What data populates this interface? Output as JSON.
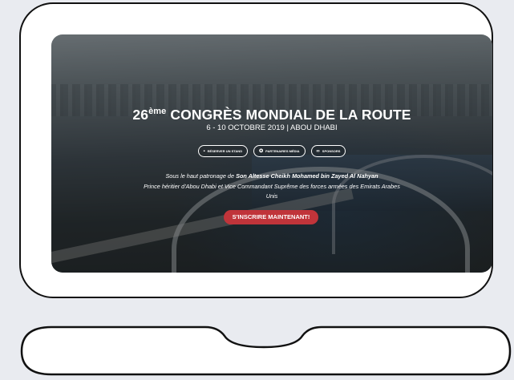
{
  "hero": {
    "title_number": "26",
    "title_sup": "ème",
    "title_rest": "CONGRÈS MONDIAL DE LA ROUTE",
    "dates": "6 - 10 OCTOBRE 2019 | ABOU DHABI",
    "buttons": [
      {
        "icon": "document-icon",
        "label": "RÉSERVER UN STAND"
      },
      {
        "icon": "star-icon",
        "label": "PARTENAIRES MÉDIA"
      },
      {
        "icon": "link-icon",
        "label": "SPONSORS"
      }
    ],
    "patronage": {
      "prefix": "Sous le haut patronage de ",
      "name": "Son Altesse Cheikh Mohamed bin Zayed Al Nahyan",
      "line2": "Prince héritier d'Abou Dhabi et Vice Commandant Suprême des forces armées des Emirats Arabes",
      "line3": "Unis"
    },
    "cta_label": "S'INSCRIRE MAINTENANT!"
  },
  "colors": {
    "cta": "#c0343a",
    "outline": "#111111",
    "background": "#e9ebf0"
  }
}
